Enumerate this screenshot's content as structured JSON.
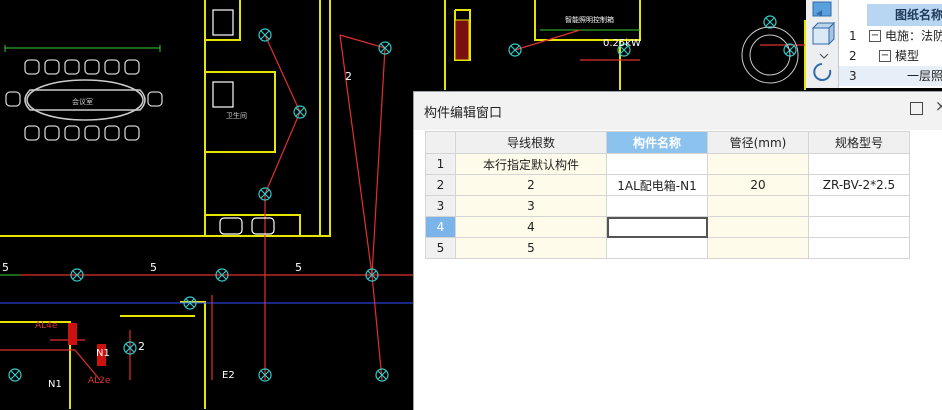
{
  "cad": {
    "room_label_meeting": "会议室",
    "room_label_restroom": "卫生间",
    "panel_label": "智能照明控制箱",
    "power_label": "0.25kW",
    "wire_count_labels": [
      "2",
      "2"
    ],
    "dim_labels": [
      "5",
      "5",
      "5"
    ],
    "circuit_labels": [
      "N1",
      "N1",
      "AL4e",
      "AL2e",
      "E2"
    ]
  },
  "drawing_list": {
    "header": "图纸名称",
    "rows": [
      {
        "num": "1",
        "toggle": "−",
        "text": "电施：法防"
      },
      {
        "num": "2",
        "toggle": "−",
        "text": "模型"
      },
      {
        "num": "3",
        "toggle": "",
        "text": "一层照"
      }
    ]
  },
  "dialog": {
    "title": "构件编辑窗口",
    "maximize_icon": "maximize-icon",
    "close_icon": "close-icon",
    "close_glyph": "×",
    "columns": [
      "导线根数",
      "构件名称",
      "管径(mm)",
      "规格型号"
    ],
    "rows": [
      {
        "num": "1",
        "wires": "本行指定默认构件",
        "name": "",
        "diameter": "",
        "spec": ""
      },
      {
        "num": "2",
        "wires": "2",
        "name": "1AL配电箱-N1",
        "diameter": "20",
        "spec": "ZR-BV-2*2.5"
      },
      {
        "num": "3",
        "wires": "3",
        "name": "",
        "diameter": "",
        "spec": ""
      },
      {
        "num": "4",
        "wires": "4",
        "name": "",
        "diameter": "",
        "spec": ""
      },
      {
        "num": "5",
        "wires": "5",
        "name": "",
        "diameter": "",
        "spec": ""
      }
    ],
    "selected_row": "4",
    "highlight_column": "构件名称"
  },
  "colors": {
    "cad_background": "#000000",
    "wall_yellow": "#e5e500",
    "wire_red": "#e03030",
    "fixture_cyan": "#33cccc",
    "dimension_green": "#33cc33",
    "header_highlight": "#8cc2ee",
    "input_column": "#fefbea"
  }
}
